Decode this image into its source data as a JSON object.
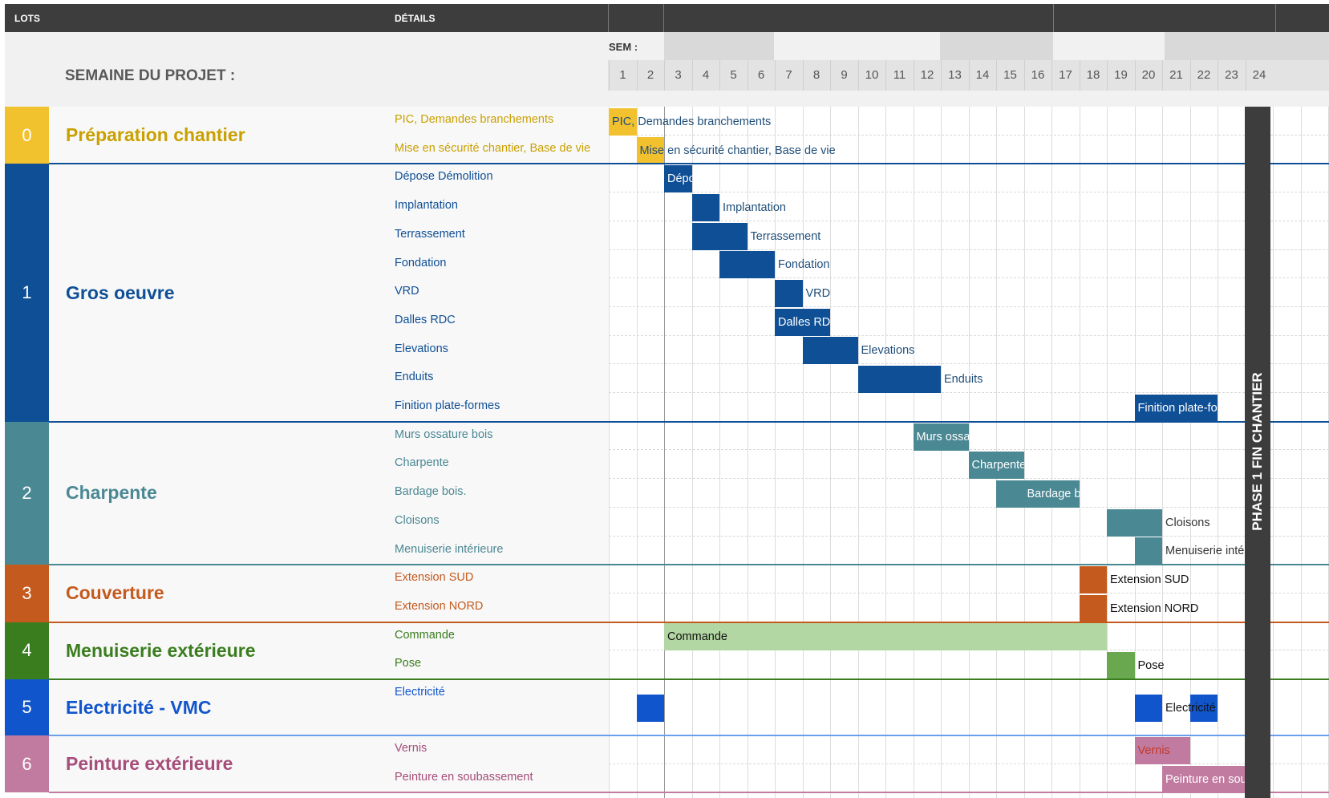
{
  "header": {
    "lots_label": "LOTS",
    "details_label": "DÉTAILS",
    "sem_label": "SEM :",
    "week_title": "SEMAINE DU PROJET :"
  },
  "weeks": [
    "1",
    "2",
    "3",
    "4",
    "5",
    "6",
    "7",
    "8",
    "9",
    "10",
    "11",
    "12",
    "13",
    "14",
    "15",
    "16",
    "17",
    "18",
    "19",
    "20",
    "21",
    "22",
    "23",
    "24"
  ],
  "milestone": {
    "label": "PHASE 1 FIN CHANTIER",
    "after_week": 23
  },
  "lots": [
    {
      "num": "0",
      "name": "Préparation chantier",
      "color": "#f2c12e",
      "text_color": "#c9a000",
      "line": "#f2c12e",
      "tasks": [
        {
          "label": "PIC, Demandes branchements",
          "bars": [
            {
              "start": 1,
              "end": 1,
              "fill": "#f2c12e"
            }
          ],
          "bar_label": "PIC, Demandes branchements",
          "label_week": 1,
          "label_color": "#1f4e79",
          "label_on_bar": true
        },
        {
          "label": "Mise en sécurité chantier, Base de vie",
          "bars": [
            {
              "start": 2,
              "end": 2,
              "fill": "#f2c12e"
            }
          ],
          "bar_label": "Mise en sécurité chantier, Base de vie",
          "label_week": 2,
          "label_color": "#1f4e79",
          "label_on_bar": true
        }
      ]
    },
    {
      "num": "1",
      "name": "Gros oeuvre",
      "color": "#0f4f96",
      "text_color": "#0f4f96",
      "line": "#0f4f96",
      "tasks": [
        {
          "label": "Dépose Démolition",
          "bars": [
            {
              "start": 3,
              "end": 3,
              "fill": "#0f4f96"
            }
          ],
          "bar_label": "Dépose Démolition",
          "label_week": 3,
          "label_color": "#ffffff",
          "label_on_bar": true,
          "clip": true
        },
        {
          "label": "Implantation",
          "bars": [
            {
              "start": 4,
              "end": 4,
              "fill": "#0f4f96"
            }
          ],
          "bar_label": "Implantation",
          "label_week": 5,
          "label_color": "#1f4e79"
        },
        {
          "label": "Terrassement",
          "bars": [
            {
              "start": 4,
              "end": 5,
              "fill": "#0f4f96"
            }
          ],
          "bar_label": "Terrassement",
          "label_week": 6,
          "label_color": "#1f4e79"
        },
        {
          "label": "Fondation",
          "bars": [
            {
              "start": 5,
              "end": 6,
              "fill": "#0f4f96"
            }
          ],
          "bar_label": "Fondation",
          "label_week": 7,
          "label_color": "#1f4e79"
        },
        {
          "label": "VRD",
          "bars": [
            {
              "start": 7,
              "end": 7,
              "fill": "#0f4f96"
            }
          ],
          "bar_label": "VRD",
          "label_week": 8,
          "label_color": "#1f4e79"
        },
        {
          "label": "Dalles RDC",
          "bars": [
            {
              "start": 7,
              "end": 8,
              "fill": "#0f4f96"
            }
          ],
          "bar_label": "Dalles RDC",
          "label_week": 7,
          "label_color": "#ffffff",
          "label_on_bar": true,
          "clip": true
        },
        {
          "label": "Elevations",
          "bars": [
            {
              "start": 8,
              "end": 9,
              "fill": "#0f4f96"
            }
          ],
          "bar_label": "Elevations",
          "label_week": 10,
          "label_color": "#1f4e79"
        },
        {
          "label": "Enduits",
          "bars": [
            {
              "start": 10,
              "end": 12,
              "fill": "#0f4f96"
            }
          ],
          "bar_label": "Enduits",
          "label_week": 13,
          "label_color": "#1f4e79"
        },
        {
          "label": "Finition plate-formes",
          "bars": [
            {
              "start": 20,
              "end": 22,
              "fill": "#0f4f96"
            }
          ],
          "bar_label": "Finition plate-formes",
          "label_week": 20,
          "label_color": "#ffffff",
          "label_on_bar": true,
          "clip": true
        }
      ]
    },
    {
      "num": "2",
      "name": "Charpente",
      "color": "#4a8893",
      "text_color": "#4a8893",
      "line": "#0f4f96",
      "tasks": [
        {
          "label": "Murs ossature bois",
          "bars": [
            {
              "start": 12,
              "end": 13,
              "fill": "#4a8893"
            }
          ],
          "bar_label": "Murs ossature bois",
          "label_week": 12,
          "label_color": "#ffffff",
          "label_on_bar": true,
          "clip": true
        },
        {
          "label": "Charpente",
          "bars": [
            {
              "start": 14,
              "end": 15,
              "fill": "#4a8893"
            }
          ],
          "bar_label": "Charpente",
          "label_week": 14,
          "label_color": "#ffffff",
          "label_on_bar": true,
          "clip": true
        },
        {
          "label": "Bardage bois.",
          "bars": [
            {
              "start": 15,
              "end": 17,
              "fill": "#4a8893"
            }
          ],
          "bar_label": "Bardage bois.",
          "label_week": 16,
          "label_color": "#ffffff",
          "label_on_bar": true,
          "clip": true
        },
        {
          "label": "Cloisons",
          "bars": [
            {
              "start": 19,
              "end": 20,
              "fill": "#4a8893"
            }
          ],
          "bar_label": "Cloisons",
          "label_week": 21,
          "label_color": "#333333"
        },
        {
          "label": "Menuiserie intérieure",
          "bars": [
            {
              "start": 20,
              "end": 20,
              "fill": "#4a8893"
            }
          ],
          "bar_label": "Menuiserie intérieure",
          "label_week": 21,
          "label_color": "#333333",
          "clip": true
        }
      ]
    },
    {
      "num": "3",
      "name": "Couverture",
      "color": "#c55a1e",
      "text_color": "#c55a1e",
      "line": "#4a8893",
      "tasks": [
        {
          "label": "Extension SUD",
          "bars": [
            {
              "start": 18,
              "end": 18,
              "fill": "#c55a1e"
            }
          ],
          "bar_label": "Extension SUD",
          "label_week": 19,
          "label_color": "#111111"
        },
        {
          "label": "Extension NORD",
          "bars": [
            {
              "start": 18,
              "end": 18,
              "fill": "#c55a1e"
            }
          ],
          "bar_label": "Extension NORD",
          "label_week": 19,
          "label_color": "#111111"
        }
      ]
    },
    {
      "num": "4",
      "name": "Menuiserie extérieure",
      "color": "#3a7d1e",
      "text_color": "#3a7d1e",
      "line": "#c55a1e",
      "tasks": [
        {
          "label": "Commande",
          "bars": [
            {
              "start": 3,
              "end": 18,
              "fill": "#b3d7a3"
            }
          ],
          "bar_label": "Commande",
          "label_week": 3,
          "label_color": "#111111",
          "label_on_bar": true
        },
        {
          "label": "Pose",
          "bars": [
            {
              "start": 19,
              "end": 19,
              "fill": "#6aa84f"
            }
          ],
          "bar_label": "Pose",
          "label_week": 20,
          "label_color": "#111111"
        }
      ]
    },
    {
      "num": "5",
      "name": "Electricité - VMC",
      "color": "#1155cc",
      "text_color": "#1155cc",
      "line": "#3a7d1e",
      "tasks": [
        {
          "label": "Electricité",
          "bars": [
            {
              "start": 2,
              "end": 2,
              "fill": "#1155cc"
            },
            {
              "start": 20,
              "end": 20,
              "fill": "#1155cc"
            },
            {
              "start": 22,
              "end": 22,
              "fill": "#1155cc"
            }
          ],
          "bar_label": "Electricité",
          "label_week": 21,
          "label_color": "#111111"
        }
      ]
    },
    {
      "num": "6",
      "name": "Peinture extérieure",
      "color": "#c27ba0",
      "text_color": "#a64d79",
      "line": "#6d9eeb",
      "tasks": [
        {
          "label": "Vernis",
          "bars": [
            {
              "start": 20,
              "end": 21,
              "fill": "#c27ba0"
            }
          ],
          "bar_label": "Vernis",
          "label_week": 20,
          "label_color": "#c0392b",
          "label_on_bar": true
        },
        {
          "label": "Peinture en soubassement",
          "bars": [
            {
              "start": 21,
              "end": 23,
              "fill": "#c27ba0"
            }
          ],
          "bar_label": "Peinture en soubassement",
          "label_week": 21,
          "label_color": "#ffffff",
          "label_on_bar": true,
          "clip": true
        }
      ]
    }
  ]
}
